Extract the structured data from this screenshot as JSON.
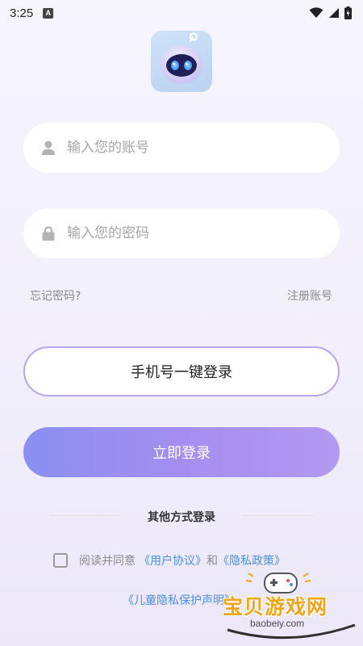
{
  "status_bar": {
    "time": "3:25",
    "notification_letter": "A"
  },
  "login": {
    "account_placeholder": "输入您的账号",
    "password_placeholder": "输入您的密码",
    "forgot_password": "忘记密码?",
    "register_account": "注册账号",
    "phone_login_button": "手机号一键登录",
    "login_button": "立即登录",
    "other_methods_title": "其他方式登录"
  },
  "agreement": {
    "prefix": "阅读并同意",
    "user_agreement": "《用户协议》",
    "and": "和",
    "privacy_policy": "《隐私政策》",
    "child_privacy": "《儿童隐私保护声明》"
  },
  "watermark": {
    "title": "宝贝游戏网",
    "domain": "baobeiy.com"
  },
  "colors": {
    "accent_gradient_start": "#8a8ff0",
    "accent_gradient_end": "#b19af1",
    "link": "#4a90e2",
    "phone_button_border": "#b8a4ef"
  },
  "icons": {
    "account": "user-icon",
    "password": "lock-icon",
    "app": "robot-logo-icon"
  }
}
